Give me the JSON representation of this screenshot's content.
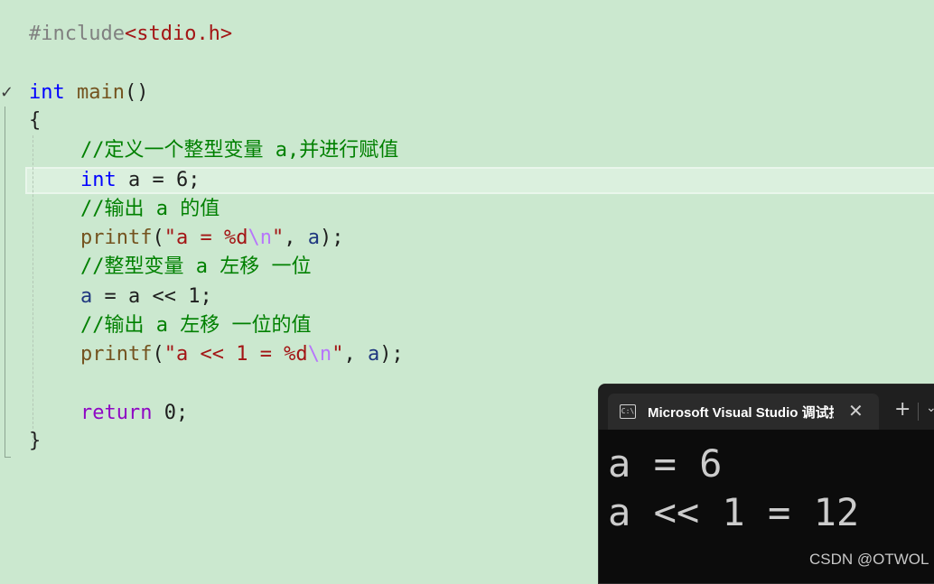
{
  "editor": {
    "include_directive": "#include",
    "include_header": "<stdio.h>",
    "kw_int": "int",
    "fn_main": "main",
    "parens": "()",
    "brace_open": "{",
    "brace_close": "}",
    "comment1": "//定义一个整型变量 a,并进行赋值",
    "decl_rest": " a = 6;",
    "comment2": "//输出 a 的值",
    "printf": "printf",
    "lparen": "(",
    "str1_start": "\"a = %d",
    "newline_escape": "\\n",
    "str_end": "\"",
    "arg_sep": ", ",
    "var_a": "a",
    "close_stmt": ");",
    "comment3": "//整型变量 a 左移 一位",
    "shift_rest": " = a << 1;",
    "comment4": "//输出 a 左移 一位的值",
    "str2_start": "\"a << 1 = %d",
    "kw_return": "return",
    "return_rest": " 0;"
  },
  "terminal": {
    "tab_icon": "C:\\",
    "tab_title": "Microsoft Visual Studio 调试控制台",
    "close_glyph": "✕",
    "add_glyph": "+",
    "dropdown_glyph": "⌄",
    "output": [
      "a = 6",
      "a << 1 = 12"
    ]
  },
  "watermark": "CSDN @OTWOL"
}
